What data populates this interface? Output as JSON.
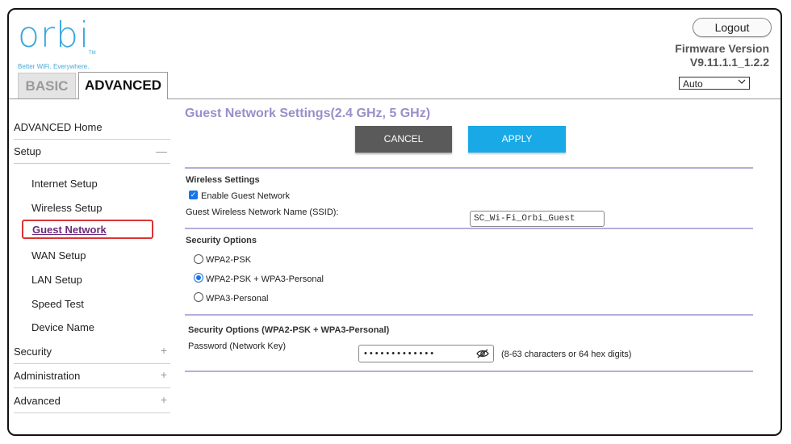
{
  "header": {
    "logo_text": "orbi",
    "logo_tm": "TM",
    "tagline": "Better WiFi. Everywhere.",
    "logout_label": "Logout",
    "firmware_label": "Firmware Version",
    "firmware_version": "V9.11.1.1_1.2.2",
    "language_selected": "Auto"
  },
  "tabs": [
    {
      "label": "BASIC",
      "active": false
    },
    {
      "label": "ADVANCED",
      "active": true
    }
  ],
  "sidebar": {
    "advanced_home": "ADVANCED Home",
    "setup": {
      "label": "Setup",
      "expanded": true
    },
    "setup_items": [
      "Internet Setup",
      "Wireless Setup",
      "Guest Network",
      "WAN Setup",
      "LAN Setup",
      "Speed Test",
      "Device Name"
    ],
    "active_item": "Guest Network",
    "security": "Security",
    "administration": "Administration",
    "advanced": "Advanced"
  },
  "main": {
    "title": "Guest Network Settings(2.4 GHz, 5 GHz)",
    "cancel_label": "CANCEL",
    "apply_label": "APPLY",
    "wireless_settings_heading": "Wireless Settings",
    "enable_guest_label": "Enable Guest Network",
    "enable_guest_checked": true,
    "ssid_label": "Guest Wireless Network Name (SSID):",
    "ssid_value": "SC_Wi-Fi_Orbi_Guest",
    "security_heading": "Security Options",
    "security_options": [
      "WPA2-PSK",
      "WPA2-PSK + WPA3-Personal",
      "WPA3-Personal"
    ],
    "security_selected": "WPA2-PSK + WPA3-Personal",
    "security_detail_heading": "Security Options (WPA2-PSK + WPA3-Personal)",
    "password_label": "Password (Network Key)",
    "password_mask": "•••••••••••••",
    "password_hint": "(8-63 characters or 64 hex digits)"
  },
  "icons": {
    "plus": "+",
    "minus": "—",
    "chevron": "chevron-down-icon",
    "eye": "eye-slash-icon"
  }
}
